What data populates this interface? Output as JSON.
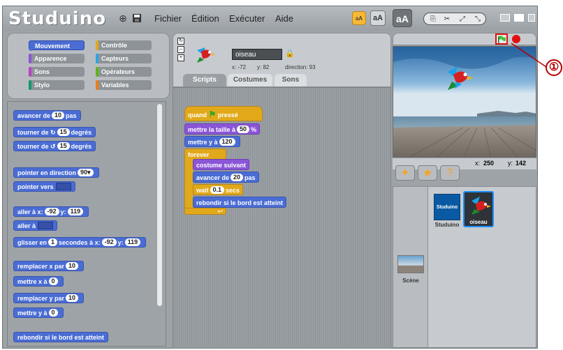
{
  "app": {
    "logo": "Studuino",
    "menu": [
      "Fichier",
      "Édition",
      "Exécuter",
      "Aide"
    ],
    "size_buttons": [
      "aA",
      "aA",
      "aA"
    ],
    "language_icon": "globe-icon",
    "save_icon": "floppy-icon"
  },
  "categories": [
    {
      "label": "Mouvement",
      "color": "#4a6cd4"
    },
    {
      "label": "Contrôle",
      "color": "#e1a91a"
    },
    {
      "label": "Apparence",
      "color": "#8a55d7"
    },
    {
      "label": "Capteurs",
      "color": "#2ca5e2"
    },
    {
      "label": "Sons",
      "color": "#bb42c3"
    },
    {
      "label": "Opérateurs",
      "color": "#5cb712"
    },
    {
      "label": "Stylo",
      "color": "#0e9a6c"
    },
    {
      "label": "Variables",
      "color": "#ee7d16"
    }
  ],
  "palette": {
    "b1": {
      "pre": "avancer de",
      "n1": "10",
      "post": "pas"
    },
    "b2": {
      "pre": "tourner de",
      "n1": "15",
      "post": "degrés"
    },
    "b3": {
      "pre": "tourner de",
      "n1": "15",
      "post": "degrés"
    },
    "b4": {
      "pre": "pointer en direction",
      "n1": "90▾"
    },
    "b5": {
      "pre": "pointer vers"
    },
    "b6": {
      "pre": "aller à x:",
      "n1": "-92",
      "mid": "y:",
      "n2": "119"
    },
    "b7": {
      "pre": "aller à"
    },
    "b8": {
      "pre": "glisser en",
      "n1": "1",
      "mid": "secondes à x:",
      "n2": "-92",
      "mid2": "y:",
      "n3": "119"
    },
    "b9": {
      "pre": "remplacer x par",
      "n1": "10"
    },
    "b10": {
      "pre": "mettre x à",
      "n1": "0"
    },
    "b11": {
      "pre": "remplacer y par",
      "n1": "10"
    },
    "b12": {
      "pre": "mettre y à",
      "n1": "0"
    },
    "b13": {
      "pre": "rebondir si le bord est atteint"
    }
  },
  "sprite": {
    "name": "oiseau",
    "x": "x: -72",
    "y": "y: 82",
    "direction": "direction: 93",
    "tabs": [
      "Scripts",
      "Costumes",
      "Sons"
    ]
  },
  "script": {
    "hat": "quand",
    "hat_post": "pressé",
    "s1": {
      "pre": "mettre la taille à",
      "n1": "50",
      "post": "%"
    },
    "s2": {
      "pre": "mettre y à",
      "n1": "120"
    },
    "forever": "forever",
    "s3": {
      "pre": "costume suivant"
    },
    "s4": {
      "pre": "avancer de",
      "n1": "20",
      "post": "pas"
    },
    "s5": {
      "pre": "wait",
      "n1": "0.1",
      "post": "secs"
    },
    "s6": {
      "pre": "rebondir si le bord est atteint"
    }
  },
  "stage": {
    "mouse_x_label": "x:",
    "mouse_x": "250",
    "mouse_y_label": "y:",
    "mouse_y": "142"
  },
  "sprites": [
    {
      "name": "Studuino",
      "thumb_text": "Studuino"
    },
    {
      "name": "oiseau"
    }
  ],
  "scene_label": "Scène",
  "annotation": "①"
}
